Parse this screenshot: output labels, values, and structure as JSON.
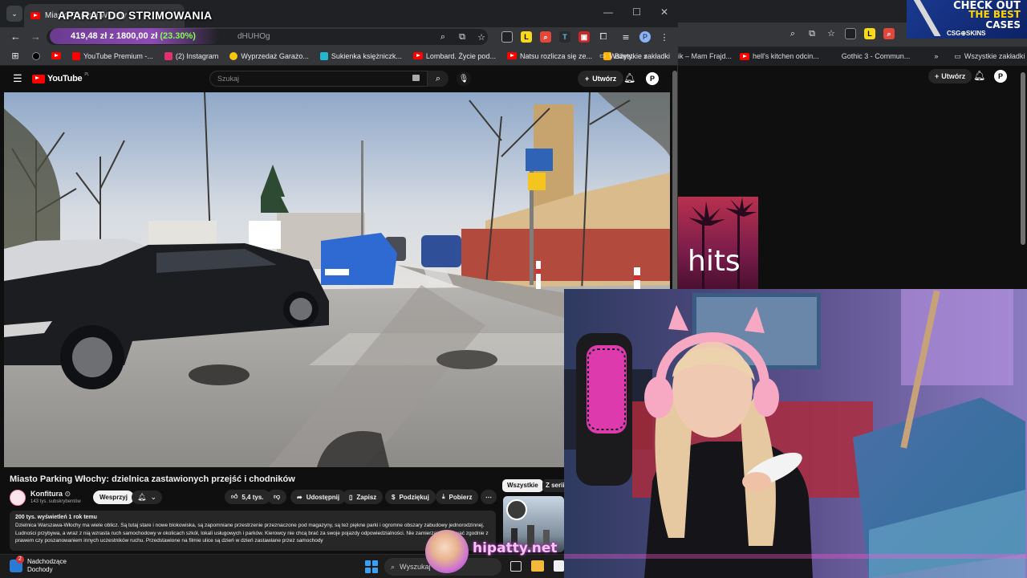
{
  "stream_overlay": {
    "title": "APARAT DO STRIMOWANIA",
    "crypto_price": "419,48 zł",
    "crypto_target": "z 1800,00 zł",
    "crypto_pct": "(23.30%)"
  },
  "browser": {
    "tab_title": "Miasto Parking Włochy",
    "url_fragment": "dHUHOg",
    "window_controls": [
      "—",
      "☐",
      "✕"
    ],
    "profile_initial": "P"
  },
  "bookmarks": {
    "items": [
      {
        "label": "YouTube Premium -...",
        "color": "#ff0000"
      },
      {
        "label": "(2) Instagram",
        "color": "#e1306c"
      },
      {
        "label": "Wyprzedaż Garażo...",
        "color": "#f9c80e"
      },
      {
        "label": "Sukienka księżniczk...",
        "color": "#22b8cf"
      },
      {
        "label": "Lombard. Życie pod...",
        "color": "#ff0000"
      },
      {
        "label": "Natsu rozlicza się ze...",
        "color": "#ff0000"
      },
      {
        "label": "Bilety",
        "color": "#ffb300"
      }
    ],
    "all_label": "Wszystkie zakładki"
  },
  "bg_browser": {
    "bookmarks": [
      "ik – Mam Frajd...",
      "hell's kitchen odcin...",
      "Gothic 3 - Commun..."
    ],
    "all_label": "Wszystkie zakładki",
    "create_label": "Utwórz",
    "thumb_text": "hits"
  },
  "promo": {
    "line1": "CHECK OUT",
    "line2": "THE BEST",
    "line3": "CASES",
    "brand": "CSG⊕SKINS"
  },
  "youtube": {
    "logo": "YouTube",
    "logo_sup": "PL",
    "search_placeholder": "Szukaj",
    "create_label": "Utwórz",
    "avatar_initial": "P",
    "video": {
      "title": "Miasto Parking Włochy: dzielnica zastawionych przejść i chodników",
      "channel": "Konfitura",
      "subscribers": "143 tys. subskrybentów",
      "support_label": "Wesprzyj",
      "likes": "5,4 tys.",
      "share_label": "Udostępnij",
      "save_label": "Zapisz",
      "thanks_label": "Podziękuj",
      "download_label": "Pobierz",
      "meta": "200 tys. wyświetleń  1 rok temu",
      "description": "Dzielnica Warszawa-Włochy ma wiele oblicz. Są tutaj stare i nowe blokowiska, są zapomniane przestrzenie przeznaczone pod magazyny, są też piękne parki i ogromne obszary zabudowy jednorodzinnej. Ludności przybywa, a wraz z nią wzrasta ruch samochodowy w okolicach szkół, lokali usługowych i parków. Kierowcy nie chcą brać za swoje pojazdy odpowiedzialności. Nie zamierzają parkować zgodnie z prawem czy poszanowaniem innych uczestników ruchu. Przedstawione na filmie ulice są dzień w dzień zastawiane przez samochody"
    },
    "chips": [
      "Wszystkie",
      "Z serii"
    ]
  },
  "taskbar": {
    "widget_title": "Nadchodzące",
    "widget_subtitle": "Dochody",
    "widget_badge": "2",
    "search_placeholder": "Wyszukaj"
  },
  "watermark": {
    "text": "hipatty.net"
  }
}
